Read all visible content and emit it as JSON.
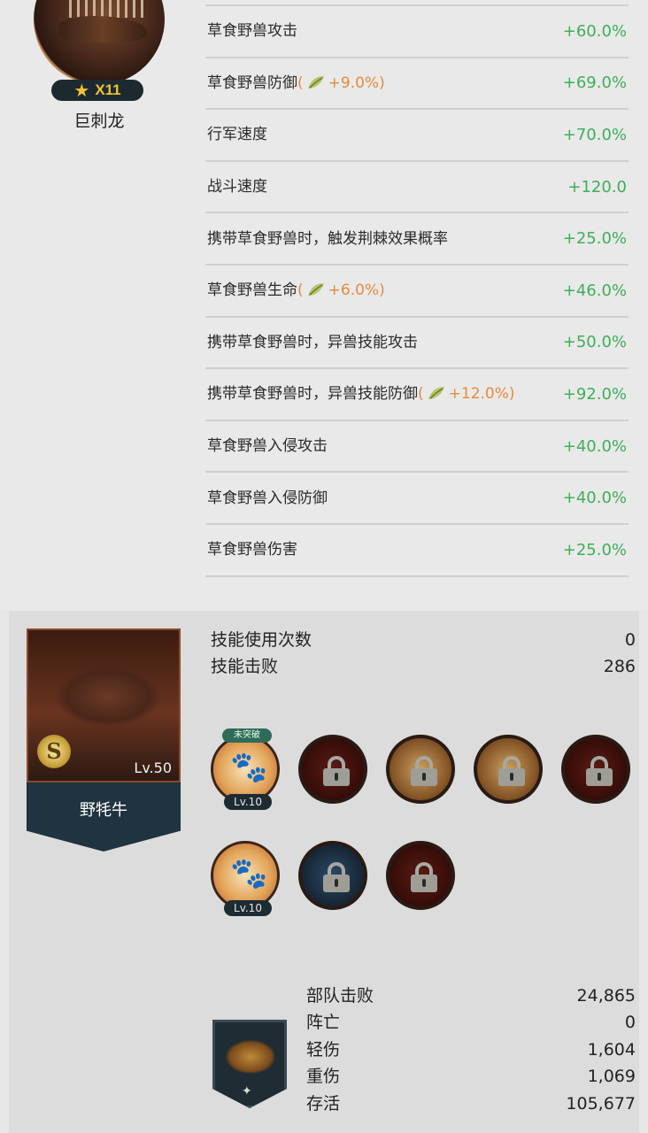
{
  "beast": {
    "stars": "X11",
    "name": "巨刺龙"
  },
  "stats": [
    {
      "label": "草食野兽攻击",
      "bonus": "",
      "value": "+60.0%"
    },
    {
      "label": "草食野兽防御",
      "bonus": "+9.0%",
      "value": "+69.0%"
    },
    {
      "label": "行军速度",
      "bonus": "",
      "value": "+70.0%"
    },
    {
      "label": "战斗速度",
      "bonus": "",
      "value": "+120.0"
    },
    {
      "label": "携带草食野兽时，触发荆棘效果概率",
      "bonus": "",
      "value": "+25.0%"
    },
    {
      "label": "草食野兽生命",
      "bonus": "+6.0%",
      "value": "+46.0%"
    },
    {
      "label": "携带草食野兽时，异兽技能攻击",
      "bonus": "",
      "value": "+50.0%"
    },
    {
      "label": "携带草食野兽时，异兽技能防御",
      "bonus": "+12.0%",
      "value": "+92.0%"
    },
    {
      "label": "草食野兽入侵攻击",
      "bonus": "",
      "value": "+40.0%"
    },
    {
      "label": "草食野兽入侵防御",
      "bonus": "",
      "value": "+40.0%"
    },
    {
      "label": "草食野兽伤害",
      "bonus": "",
      "value": "+25.0%"
    }
  ],
  "pet": {
    "grade": "S",
    "level": "Lv.50",
    "name": "野牦牛"
  },
  "skill_stats": [
    {
      "label": "技能使用次数",
      "value": "0"
    },
    {
      "label": "技能击败",
      "value": "286"
    }
  ],
  "skills": [
    {
      "state": "unlocked",
      "level": "Lv.10",
      "tag": "未突破",
      "icon": "paw-icon"
    },
    {
      "state": "locked",
      "style": "red",
      "icon": "lock-icon"
    },
    {
      "state": "locked",
      "style": "gold",
      "icon": "lock-icon"
    },
    {
      "state": "locked",
      "style": "gold",
      "icon": "lock-icon"
    },
    {
      "state": "locked",
      "style": "red",
      "icon": "lock-icon"
    },
    {
      "state": "unlocked",
      "level": "Lv.10",
      "tag": "",
      "icon": "paw-icon"
    },
    {
      "state": "locked",
      "style": "blue",
      "icon": "lock-icon"
    },
    {
      "state": "locked",
      "style": "red",
      "icon": "lock-icon"
    }
  ],
  "troop_stats": [
    {
      "label": "部队击败",
      "value": "24,865"
    },
    {
      "label": "阵亡",
      "value": "0"
    },
    {
      "label": "轻伤",
      "value": "1,604"
    },
    {
      "label": "重伤",
      "value": "1,069"
    },
    {
      "label": "存活",
      "value": "105,677"
    }
  ],
  "colors": {
    "positive": "#3fae5a",
    "bonus": "#e98a3a",
    "banner": "#1f3340"
  }
}
